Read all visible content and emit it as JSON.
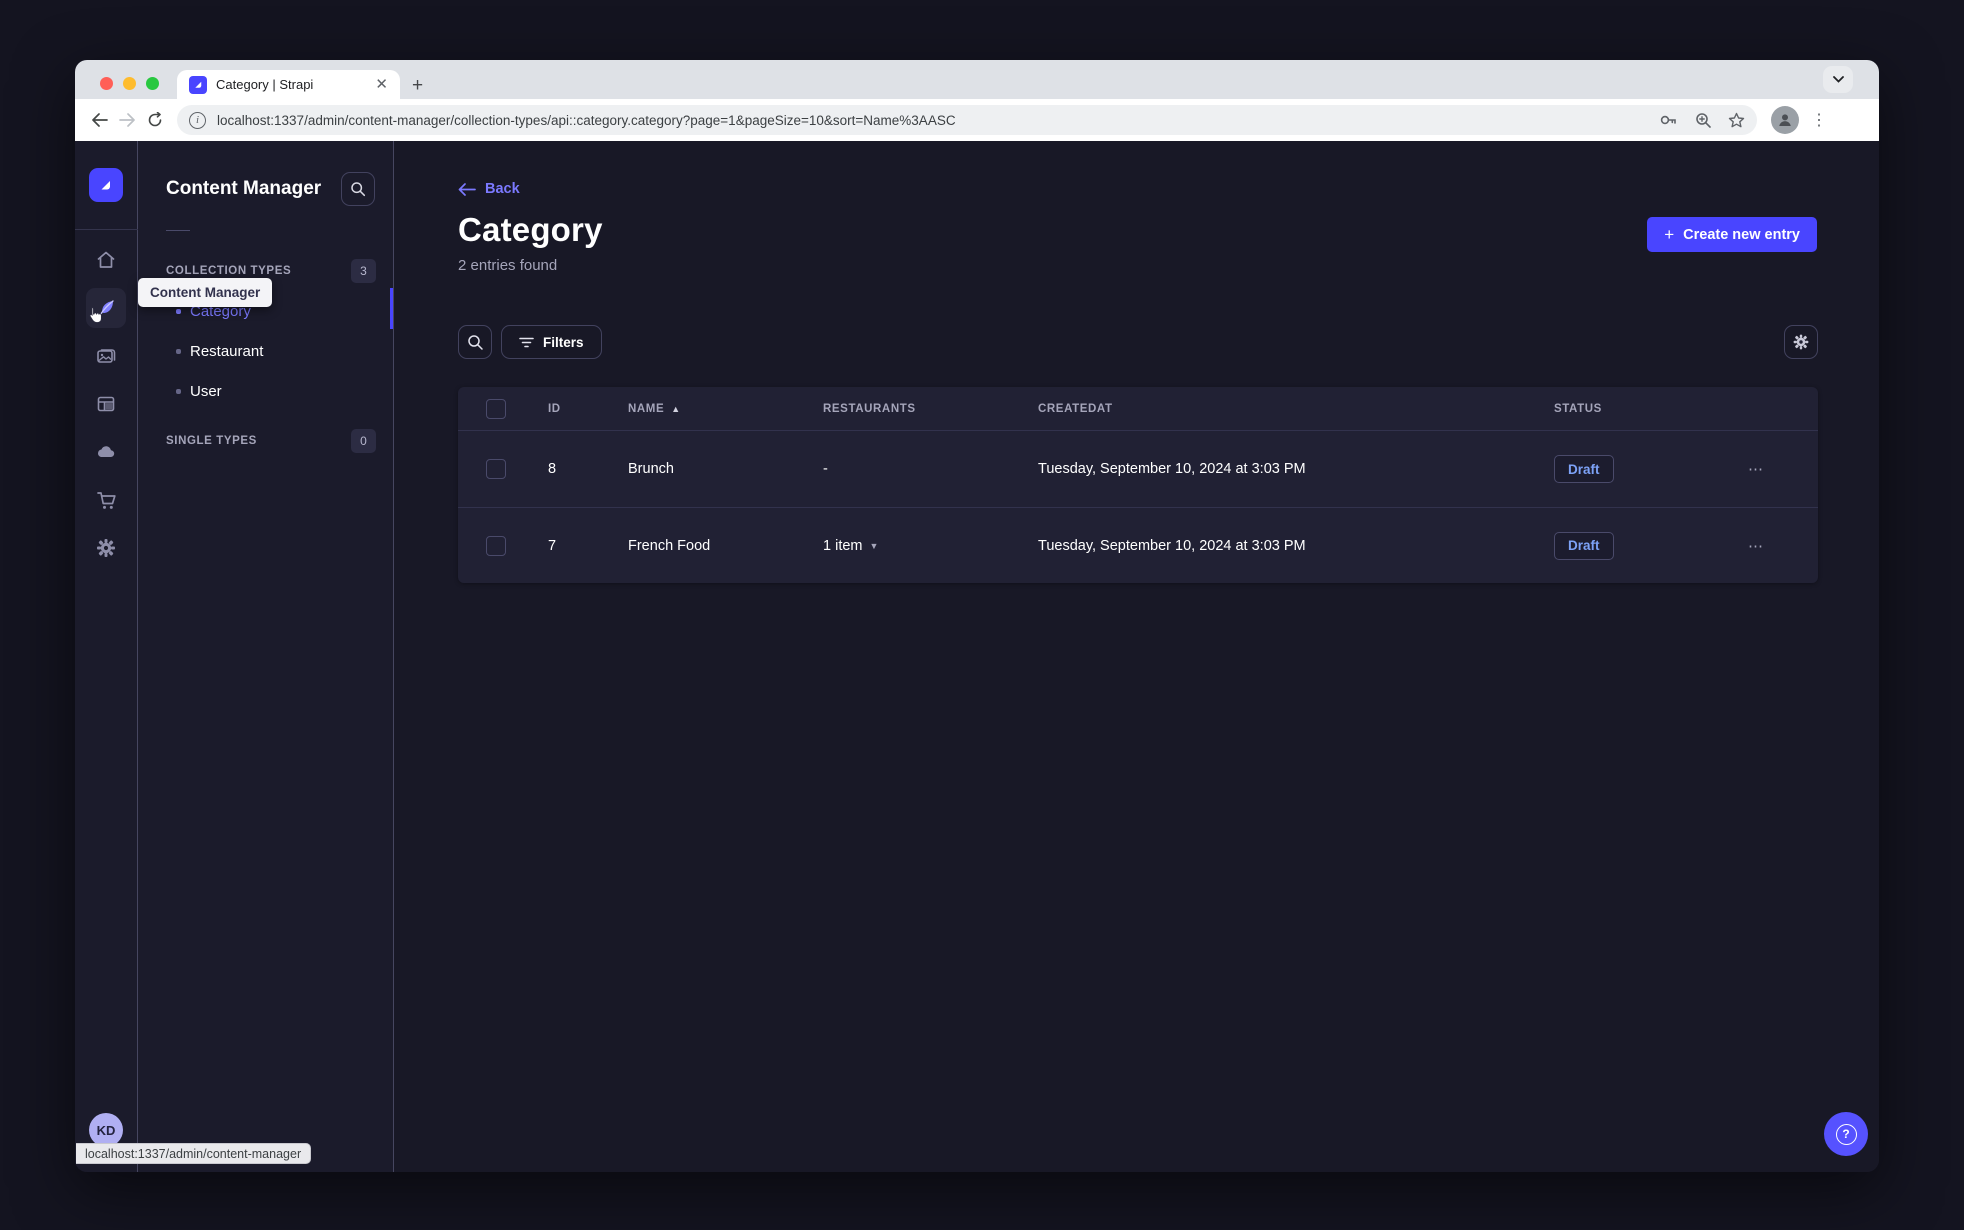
{
  "browser": {
    "tab_title": "Category | Strapi",
    "url": "localhost:1337/admin/content-manager/collection-types/api::category.category?page=1&pageSize=10&sort=Name%3AASC",
    "status_bubble": "localhost:1337/admin/content-manager"
  },
  "colors": {
    "primary": "#4945ff",
    "link": "#7b79ff",
    "draft_text": "#7da2f7",
    "page_bg": "#181826",
    "card_bg": "#212134"
  },
  "icons": {
    "tab_favicon": "strapi-logo",
    "rail": [
      "home",
      "content-manager-feather",
      "media-library",
      "content-type-builder",
      "cloud",
      "marketplace-cart",
      "settings-gear"
    ],
    "omnibox_right": [
      "password-key",
      "zoom-magnifier",
      "bookmark-star"
    ]
  },
  "sidebar": {
    "tooltip": "Content Manager",
    "user_initials": "KD"
  },
  "nav_panel": {
    "title": "Content Manager",
    "sections": [
      {
        "label": "COLLECTION TYPES",
        "count": "3",
        "items": [
          {
            "label": "Category",
            "active": true
          },
          {
            "label": "Restaurant",
            "active": false
          },
          {
            "label": "User",
            "active": false
          }
        ]
      },
      {
        "label": "SINGLE TYPES",
        "count": "0",
        "items": []
      }
    ]
  },
  "main": {
    "back_label": "Back",
    "title": "Category",
    "subtitle": "2 entries found",
    "create_button": "Create new entry",
    "filters_button": "Filters",
    "table": {
      "headers": [
        "ID",
        "NAME",
        "RESTAURANTS",
        "CREATEDAT",
        "STATUS"
      ],
      "sort": {
        "column": "NAME",
        "direction": "asc"
      },
      "rows": [
        {
          "id": "8",
          "name": "Brunch",
          "restaurants": "-",
          "createdAt": "Tuesday, September 10, 2024 at 3:03 PM",
          "status": "Draft"
        },
        {
          "id": "7",
          "name": "French Food",
          "restaurants": "1 item",
          "createdAt": "Tuesday, September 10, 2024 at 3:03 PM",
          "status": "Draft"
        }
      ]
    }
  }
}
